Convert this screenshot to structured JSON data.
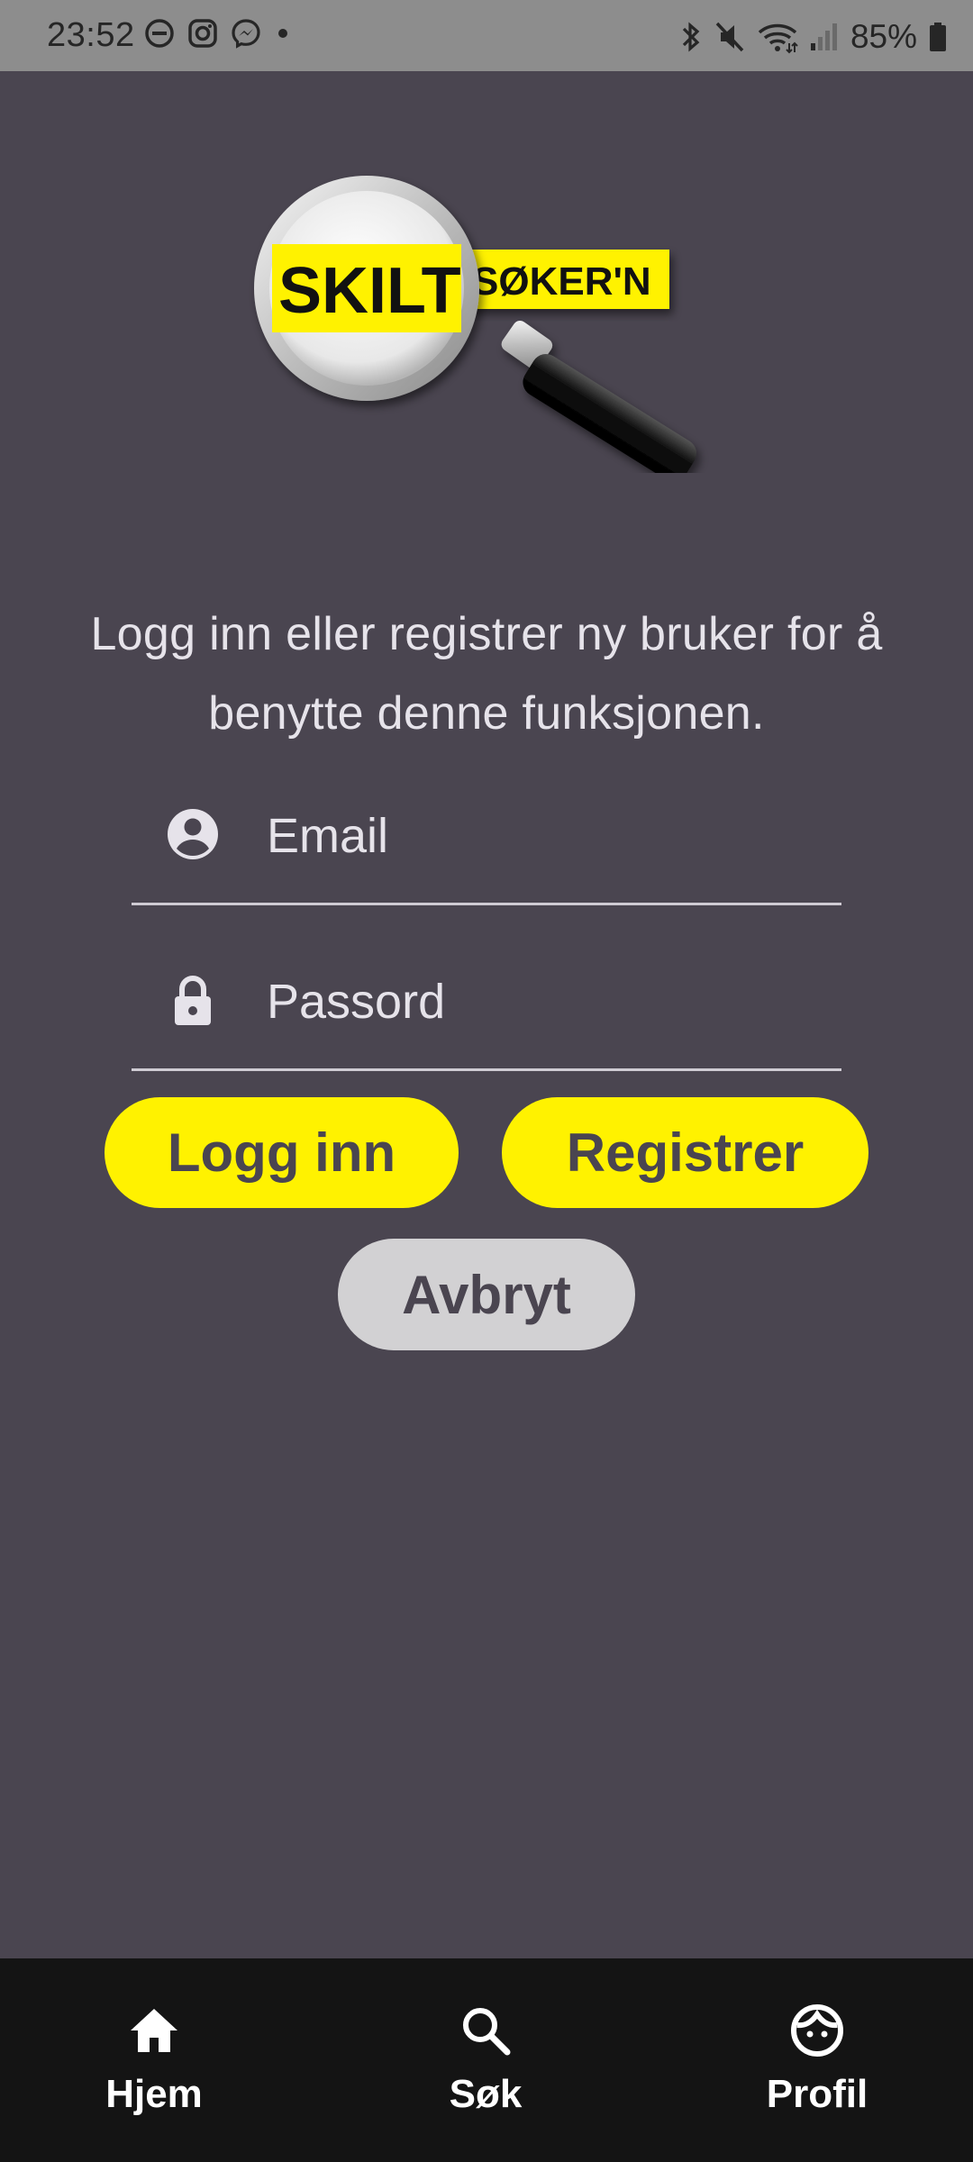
{
  "status_bar": {
    "time": "23:52",
    "battery": "85%",
    "left_icons": [
      "do-not-disturb-icon",
      "instagram-icon",
      "messenger-icon",
      "dot-icon"
    ],
    "right_icons": [
      "bluetooth-icon",
      "mute-icon",
      "wifi-icon",
      "signal-icon",
      "battery-icon"
    ]
  },
  "logo": {
    "word1": "SKILT",
    "word2": "SØKER'N"
  },
  "login": {
    "message": "Logg inn eller registrer ny bruker for å benytte denne funksjonen.",
    "email_placeholder": "Email",
    "password_placeholder": "Passord",
    "login_button": "Logg inn",
    "register_button": "Registrer",
    "cancel_button": "Avbryt"
  },
  "nav": {
    "items": [
      {
        "label": "Hjem",
        "icon": "home-icon"
      },
      {
        "label": "Søk",
        "icon": "search-icon"
      },
      {
        "label": "Profil",
        "icon": "profile-face-icon"
      }
    ]
  },
  "colors": {
    "background": "#4a4550",
    "accent_yellow": "#fff200",
    "cancel_grey": "#d2d1d3",
    "nav_background": "#141414",
    "status_bar": "#8d8d8d"
  }
}
